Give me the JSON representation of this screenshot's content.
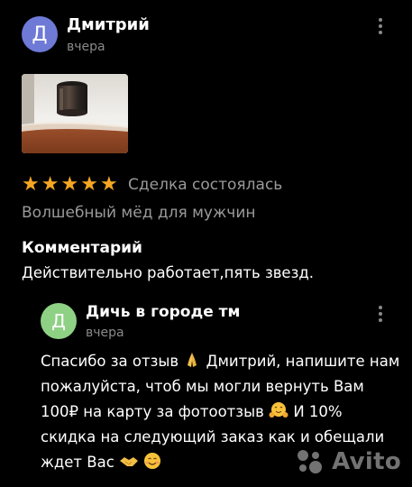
{
  "review": {
    "author_initial": "Д",
    "author_name": "Дмитрий",
    "date": "вчера",
    "rating": 5,
    "deal_status": "Сделка состоялась",
    "item_title": "Волшебный мёд для мужчин",
    "comment_heading": "Комментарий",
    "comment_text": "Действительно работает,пять звезд."
  },
  "reply": {
    "author_initial": "Д",
    "author_name": "Дичь в городе тм",
    "date": "вчера",
    "text_parts": [
      "Спасибо за отзыв",
      " Дмитрий, напишите нам пожалуйста, чтоб мы могли вернуть Вам 100₽ на карту за фотоотзыв",
      " И 10% скидка на следующий заказ как и обещали ждет Вас"
    ]
  },
  "colors": {
    "background": "#000000",
    "review_avatar": "#6e7ad6",
    "reply_avatar": "#8ed184",
    "star": "#f5a623",
    "muted_text": "#9a9a9a"
  },
  "watermark": {
    "text": "Avito"
  },
  "icons": [
    "kebab-menu-icon",
    "star-icon",
    "folded-hands-emoji",
    "hugging-face-emoji",
    "handshake-emoji",
    "smiling-face-emoji",
    "avito-logo"
  ]
}
